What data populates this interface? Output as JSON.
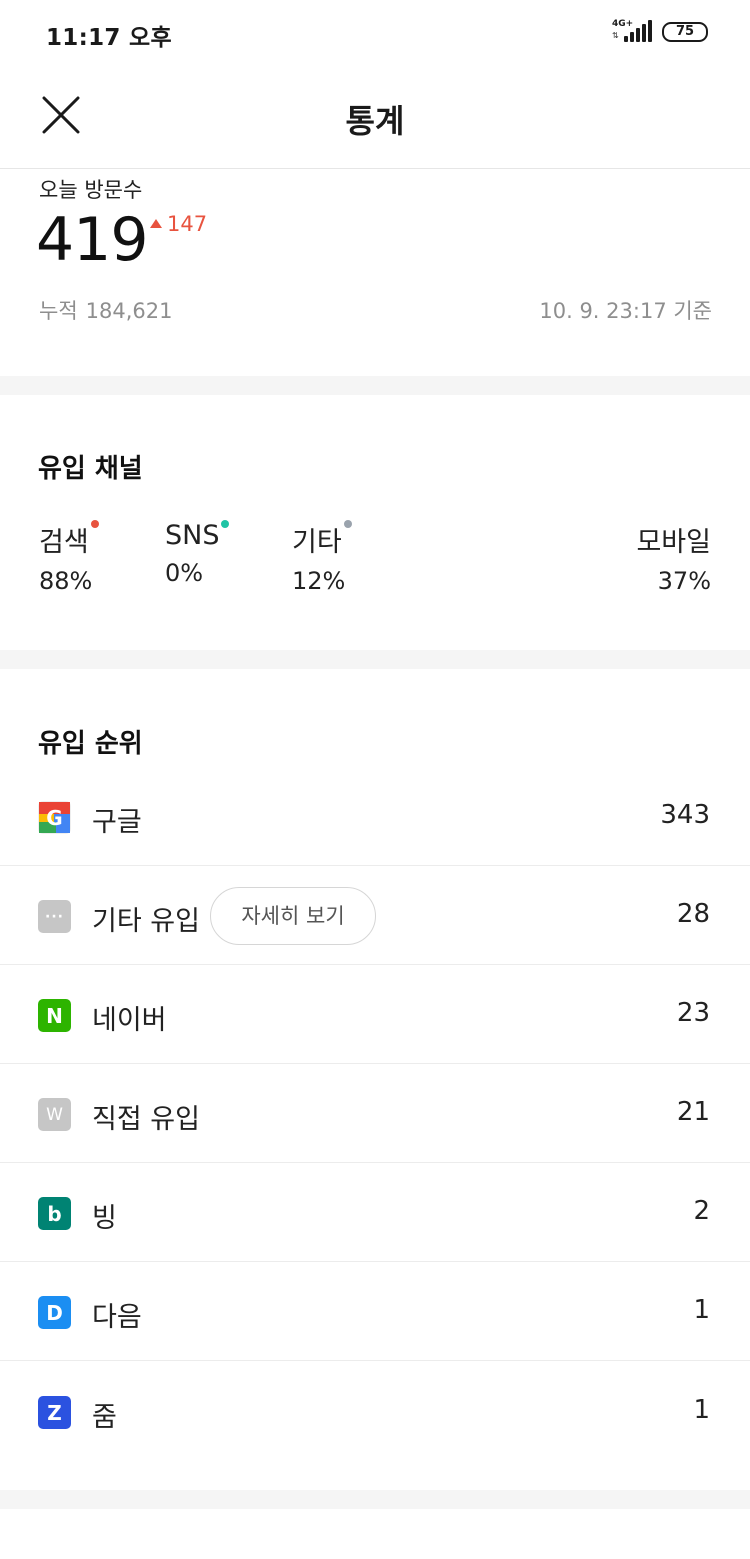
{
  "status_bar": {
    "time": "11:17 오후",
    "network": "4G+",
    "battery": "75"
  },
  "header": {
    "title": "통계"
  },
  "today": {
    "label": "오늘 방문수",
    "count": "419",
    "delta": "147",
    "cumulative_label": "누적",
    "cumulative_value": "184,621",
    "updated": "10. 9. 23:17 기준"
  },
  "channels": {
    "title": "유입 채널",
    "items": [
      {
        "name": "검색",
        "value": "88%",
        "dot_color": "#e8533f"
      },
      {
        "name": "SNS",
        "value": "0%",
        "dot_color": "#1fc4a5"
      },
      {
        "name": "기타",
        "value": "12%",
        "dot_color": "#9aa3ad"
      },
      {
        "name": "모바일",
        "value": "37%"
      }
    ]
  },
  "ranking": {
    "title": "유입 순위",
    "detail_button": "자세히 보기",
    "items": [
      {
        "name": "구글",
        "value": "343",
        "icon": "google-icon"
      },
      {
        "name": "기타 유입",
        "value": "28",
        "icon": "more-dots-icon"
      },
      {
        "name": "네이버",
        "value": "23",
        "icon": "naver-icon"
      },
      {
        "name": "직접 유입",
        "value": "21",
        "icon": "direct-icon"
      },
      {
        "name": "빙",
        "value": "2",
        "icon": "bing-icon"
      },
      {
        "name": "다음",
        "value": "1",
        "icon": "daum-icon"
      },
      {
        "name": "줌",
        "value": "1",
        "icon": "zum-icon"
      }
    ]
  },
  "colors": {
    "accent_red": "#e8533f",
    "sns_teal": "#1fc4a5",
    "other_gray": "#9aa3ad",
    "naver_green": "#2db400",
    "bing_teal": "#008373",
    "daum_blue": "#1b8ef2",
    "zum_blue": "#2b52e0"
  }
}
